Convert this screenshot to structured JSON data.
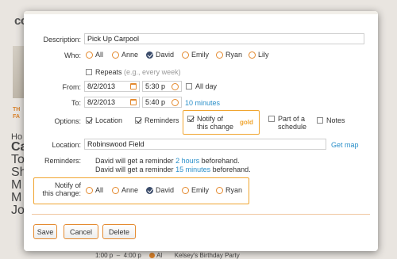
{
  "background": {
    "logo": "co",
    "column_letters": [
      "Ho",
      "Ca",
      "To",
      "Sh",
      "M",
      "M",
      "Jo"
    ],
    "orange_text": [
      "TH",
      "FA"
    ],
    "bottom_row": {
      "time_from": "1:00 p",
      "time_to": "4:00 p",
      "person": "Al",
      "event": "Kelsey's Birthday Party"
    }
  },
  "form": {
    "description_label": "Description:",
    "description_value": "Pick Up Carpool",
    "who_label": "Who:",
    "who_options": [
      "All",
      "Anne",
      "David",
      "Emily",
      "Ryan",
      "Lily"
    ],
    "who_selected": "David",
    "repeats_label": "Repeats",
    "repeats_hint": "(e.g., every week)",
    "from_label": "From:",
    "from_date": "8/2/2013",
    "from_time": "5:30 p",
    "all_day_label": "All day",
    "to_label": "To:",
    "to_date": "8/2/2013",
    "to_time": "5:40 p",
    "duration": "10 minutes",
    "options_label": "Options:",
    "options": {
      "location": "Location",
      "reminders": "Reminders",
      "notify_line1": "Notify of",
      "notify_line2": "this change",
      "schedule_line1": "Part of a",
      "schedule_line2": "schedule",
      "notes": "Notes"
    },
    "gold_tag": "gold",
    "location_label": "Location:",
    "location_value": "Robinswood Field",
    "get_map": "Get map",
    "reminders_label": "Reminders:",
    "reminder1_pre": "David will get a reminder",
    "reminder1_link": "2 hours",
    "reminder1_post": "beforehand.",
    "reminder2_pre": "David will get a reminder",
    "reminder2_link": "15 minutes",
    "reminder2_post": "beforehand.",
    "notify_label_line1": "Notify of",
    "notify_label_line2": "this change:",
    "notify_options": [
      "All",
      "Anne",
      "David",
      "Emily",
      "Ryan"
    ],
    "notify_selected": "David"
  },
  "buttons": {
    "save": "Save",
    "cancel": "Cancel",
    "delete": "Delete"
  },
  "colors": {
    "accent": "#e48a2f",
    "highlight": "#f0a530",
    "link": "#2a8fc9",
    "selected": "#3b4c6b"
  }
}
